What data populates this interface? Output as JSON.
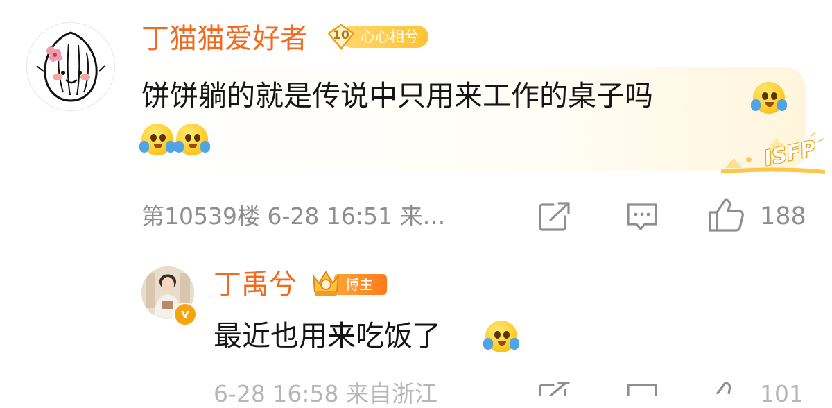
{
  "comment": {
    "username": "丁猫猫爱好者",
    "fan_badge": {
      "level": "10",
      "label": "心心相兮"
    },
    "text": "饼饼躺的就是传说中只用来工作的桌子吗",
    "meta": "第10539楼 6-28 16:51 来…",
    "like_count": "188",
    "personality_tag": "ISFP",
    "icons": [
      "share-icon",
      "comment-icon",
      "like-icon",
      "cry-emoji"
    ]
  },
  "reply": {
    "username": "丁禹兮",
    "host_badge": "博主",
    "verified_mark": "v",
    "text": "最近也用来吃饭了",
    "meta_partial": "6-28 16:58 来自浙江",
    "like_count_partial": "101"
  },
  "colors": {
    "username": "#f06a1f",
    "meta": "#8e8e8e",
    "text": "#151515",
    "badge_gold": "#ffc233",
    "badge_orange": "#ff7a1c"
  }
}
